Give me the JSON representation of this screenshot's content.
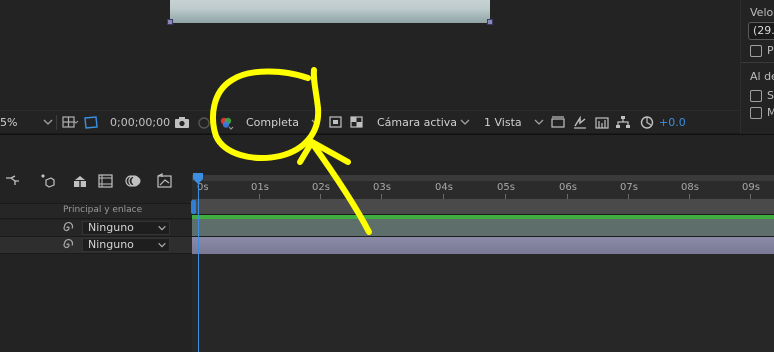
{
  "right_panel": {
    "velocity_label": "Veloc",
    "fps_value": "(29.",
    "option_p": "P",
    "section_label": "Al de",
    "option_s": "S",
    "option_m": "M"
  },
  "viewer_toolbar": {
    "zoom_value": "5%",
    "timecode": "0;00;00;00",
    "resolution": "Completa",
    "camera": "Cámara activa",
    "views": "1 Vista",
    "exposure": "+0.0"
  },
  "timeline": {
    "column_label": "Principal y enlace",
    "layers": [
      {
        "parent": "Ninguno"
      },
      {
        "parent": "Ninguno"
      }
    ],
    "ruler_ticks": [
      "0s",
      "01s",
      "02s",
      "03s",
      "04s",
      "05s",
      "06s",
      "07s",
      "08s",
      "09s"
    ]
  },
  "colors": {
    "accent_blue": "#3b8ee0",
    "annotation_yellow": "#ffff00",
    "layer_green": "#3fae3f",
    "layer_purple": "#8b8ba8"
  },
  "icons": {
    "snapshot": "camera-icon",
    "channel": "rgb-channel-icon",
    "annotation": "yellow-circle-arrow-annotation"
  }
}
